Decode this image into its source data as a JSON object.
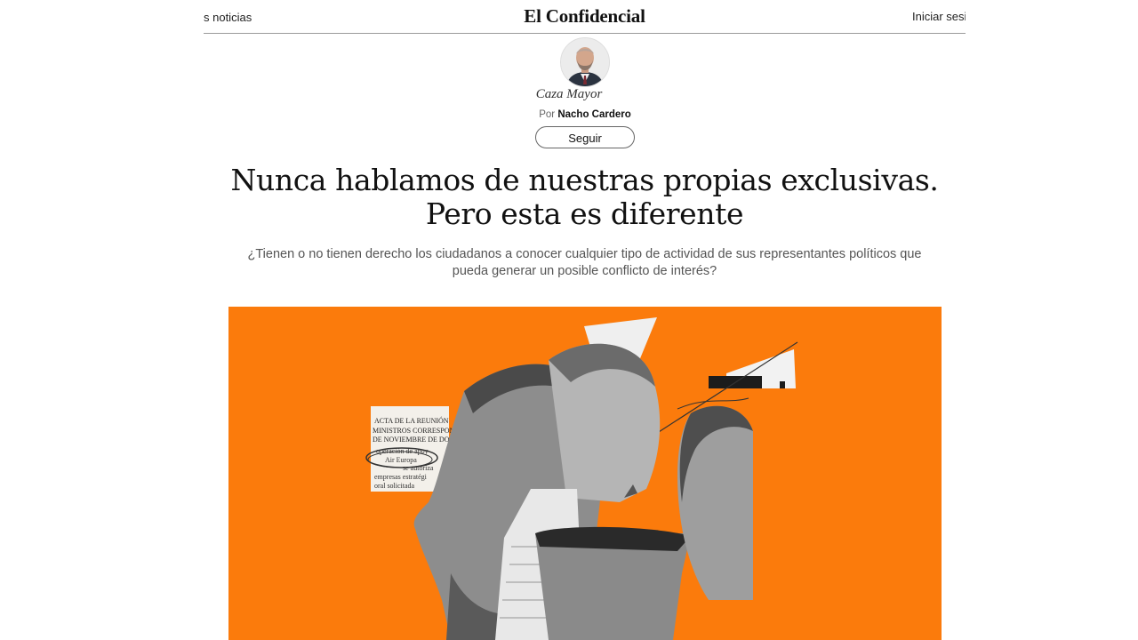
{
  "header": {
    "nav_left": "s noticias",
    "logo": "El Confidencial",
    "nav_right": "Iniciar sesi"
  },
  "author_block": {
    "section": "Caza Mayor",
    "by_prefix": "Por",
    "author": "Nacho Cardero",
    "follow_label": "Seguir"
  },
  "article": {
    "headline_line1": "Nunca hablamos de nuestras propias exclusivas.",
    "headline_line2": "Pero esta es diferente",
    "subtitle_line1": "¿Tienen o no tienen derecho los ciudadanos a conocer cualquier tipo de actividad de sus representantes políticos que",
    "subtitle_line2": "pueda generar un posible conflicto de interés?"
  },
  "hero": {
    "background_color": "#fb7b0c",
    "document_lines": [
      "ACTA DE LA REUNIÓN",
      "MINISTROS CORRESPON",
      "DE NOVIEMBRE DE DOS",
      "operación de apoy",
      "Air Europa",
      "se autoriza",
      "empresas estratégi",
      "oral solicitada"
    ]
  }
}
